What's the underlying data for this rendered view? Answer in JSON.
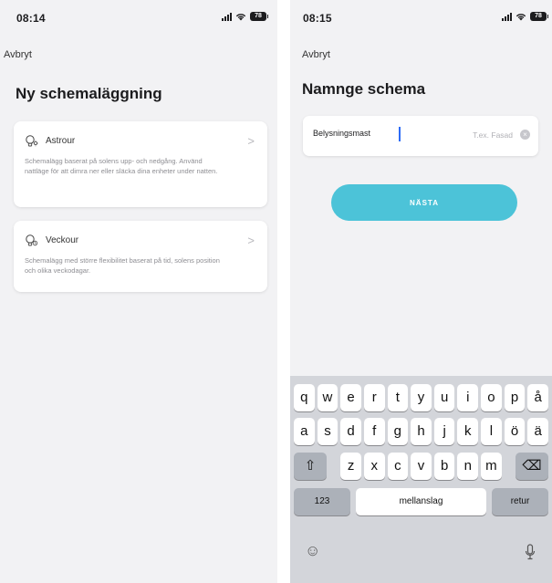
{
  "left": {
    "status": {
      "time": "08:14",
      "battery": "78"
    },
    "cancel_label": "Avbryt",
    "title": "Ny schemaläggning",
    "options": [
      {
        "icon": "bulb-sun-icon",
        "title": "Astrour",
        "description": "Schemalägg baserat på solens upp- och nedgång. Använd nattläge för att dimra ner eller släcka dina enheter under natten."
      },
      {
        "icon": "bulb-clock-icon",
        "title": "Veckour",
        "description": "Schemalägg med större flexibilitet baserat på tid, solens position och olika veckodagar."
      }
    ]
  },
  "right": {
    "status": {
      "time": "08:15",
      "battery": "78"
    },
    "cancel_label": "Avbryt",
    "title": "Namnge schema",
    "name_input": {
      "value": "Belysningsmast",
      "placeholder": "T.ex. Fasad"
    },
    "next_label": "NÄSTA",
    "keyboard": {
      "row1": [
        "q",
        "w",
        "e",
        "r",
        "t",
        "y",
        "u",
        "i",
        "o",
        "p",
        "å"
      ],
      "row2": [
        "a",
        "s",
        "d",
        "f",
        "g",
        "h",
        "j",
        "k",
        "l",
        "ö",
        "ä"
      ],
      "row3": [
        "z",
        "x",
        "c",
        "v",
        "b",
        "n",
        "m"
      ],
      "numbers_label": "123",
      "space_label": "mellanslag",
      "return_label": "retur"
    }
  }
}
